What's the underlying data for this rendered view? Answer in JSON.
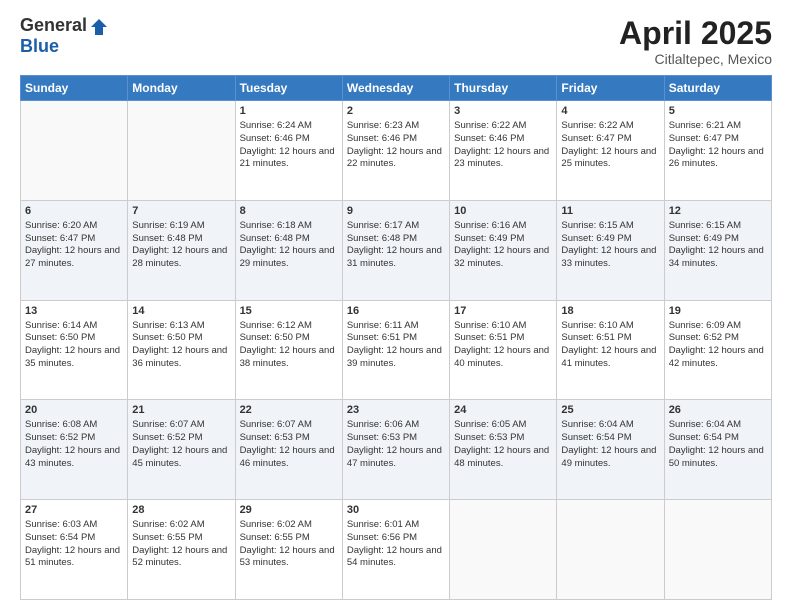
{
  "header": {
    "logo_general": "General",
    "logo_blue": "Blue",
    "title": "April 2025",
    "location": "Citlaltepec, Mexico"
  },
  "days_of_week": [
    "Sunday",
    "Monday",
    "Tuesday",
    "Wednesday",
    "Thursday",
    "Friday",
    "Saturday"
  ],
  "weeks": [
    [
      {
        "day": "",
        "sunrise": "",
        "sunset": "",
        "daylight": ""
      },
      {
        "day": "",
        "sunrise": "",
        "sunset": "",
        "daylight": ""
      },
      {
        "day": "1",
        "sunrise": "Sunrise: 6:24 AM",
        "sunset": "Sunset: 6:46 PM",
        "daylight": "Daylight: 12 hours and 21 minutes."
      },
      {
        "day": "2",
        "sunrise": "Sunrise: 6:23 AM",
        "sunset": "Sunset: 6:46 PM",
        "daylight": "Daylight: 12 hours and 22 minutes."
      },
      {
        "day": "3",
        "sunrise": "Sunrise: 6:22 AM",
        "sunset": "Sunset: 6:46 PM",
        "daylight": "Daylight: 12 hours and 23 minutes."
      },
      {
        "day": "4",
        "sunrise": "Sunrise: 6:22 AM",
        "sunset": "Sunset: 6:47 PM",
        "daylight": "Daylight: 12 hours and 25 minutes."
      },
      {
        "day": "5",
        "sunrise": "Sunrise: 6:21 AM",
        "sunset": "Sunset: 6:47 PM",
        "daylight": "Daylight: 12 hours and 26 minutes."
      }
    ],
    [
      {
        "day": "6",
        "sunrise": "Sunrise: 6:20 AM",
        "sunset": "Sunset: 6:47 PM",
        "daylight": "Daylight: 12 hours and 27 minutes."
      },
      {
        "day": "7",
        "sunrise": "Sunrise: 6:19 AM",
        "sunset": "Sunset: 6:48 PM",
        "daylight": "Daylight: 12 hours and 28 minutes."
      },
      {
        "day": "8",
        "sunrise": "Sunrise: 6:18 AM",
        "sunset": "Sunset: 6:48 PM",
        "daylight": "Daylight: 12 hours and 29 minutes."
      },
      {
        "day": "9",
        "sunrise": "Sunrise: 6:17 AM",
        "sunset": "Sunset: 6:48 PM",
        "daylight": "Daylight: 12 hours and 31 minutes."
      },
      {
        "day": "10",
        "sunrise": "Sunrise: 6:16 AM",
        "sunset": "Sunset: 6:49 PM",
        "daylight": "Daylight: 12 hours and 32 minutes."
      },
      {
        "day": "11",
        "sunrise": "Sunrise: 6:15 AM",
        "sunset": "Sunset: 6:49 PM",
        "daylight": "Daylight: 12 hours and 33 minutes."
      },
      {
        "day": "12",
        "sunrise": "Sunrise: 6:15 AM",
        "sunset": "Sunset: 6:49 PM",
        "daylight": "Daylight: 12 hours and 34 minutes."
      }
    ],
    [
      {
        "day": "13",
        "sunrise": "Sunrise: 6:14 AM",
        "sunset": "Sunset: 6:50 PM",
        "daylight": "Daylight: 12 hours and 35 minutes."
      },
      {
        "day": "14",
        "sunrise": "Sunrise: 6:13 AM",
        "sunset": "Sunset: 6:50 PM",
        "daylight": "Daylight: 12 hours and 36 minutes."
      },
      {
        "day": "15",
        "sunrise": "Sunrise: 6:12 AM",
        "sunset": "Sunset: 6:50 PM",
        "daylight": "Daylight: 12 hours and 38 minutes."
      },
      {
        "day": "16",
        "sunrise": "Sunrise: 6:11 AM",
        "sunset": "Sunset: 6:51 PM",
        "daylight": "Daylight: 12 hours and 39 minutes."
      },
      {
        "day": "17",
        "sunrise": "Sunrise: 6:10 AM",
        "sunset": "Sunset: 6:51 PM",
        "daylight": "Daylight: 12 hours and 40 minutes."
      },
      {
        "day": "18",
        "sunrise": "Sunrise: 6:10 AM",
        "sunset": "Sunset: 6:51 PM",
        "daylight": "Daylight: 12 hours and 41 minutes."
      },
      {
        "day": "19",
        "sunrise": "Sunrise: 6:09 AM",
        "sunset": "Sunset: 6:52 PM",
        "daylight": "Daylight: 12 hours and 42 minutes."
      }
    ],
    [
      {
        "day": "20",
        "sunrise": "Sunrise: 6:08 AM",
        "sunset": "Sunset: 6:52 PM",
        "daylight": "Daylight: 12 hours and 43 minutes."
      },
      {
        "day": "21",
        "sunrise": "Sunrise: 6:07 AM",
        "sunset": "Sunset: 6:52 PM",
        "daylight": "Daylight: 12 hours and 45 minutes."
      },
      {
        "day": "22",
        "sunrise": "Sunrise: 6:07 AM",
        "sunset": "Sunset: 6:53 PM",
        "daylight": "Daylight: 12 hours and 46 minutes."
      },
      {
        "day": "23",
        "sunrise": "Sunrise: 6:06 AM",
        "sunset": "Sunset: 6:53 PM",
        "daylight": "Daylight: 12 hours and 47 minutes."
      },
      {
        "day": "24",
        "sunrise": "Sunrise: 6:05 AM",
        "sunset": "Sunset: 6:53 PM",
        "daylight": "Daylight: 12 hours and 48 minutes."
      },
      {
        "day": "25",
        "sunrise": "Sunrise: 6:04 AM",
        "sunset": "Sunset: 6:54 PM",
        "daylight": "Daylight: 12 hours and 49 minutes."
      },
      {
        "day": "26",
        "sunrise": "Sunrise: 6:04 AM",
        "sunset": "Sunset: 6:54 PM",
        "daylight": "Daylight: 12 hours and 50 minutes."
      }
    ],
    [
      {
        "day": "27",
        "sunrise": "Sunrise: 6:03 AM",
        "sunset": "Sunset: 6:54 PM",
        "daylight": "Daylight: 12 hours and 51 minutes."
      },
      {
        "day": "28",
        "sunrise": "Sunrise: 6:02 AM",
        "sunset": "Sunset: 6:55 PM",
        "daylight": "Daylight: 12 hours and 52 minutes."
      },
      {
        "day": "29",
        "sunrise": "Sunrise: 6:02 AM",
        "sunset": "Sunset: 6:55 PM",
        "daylight": "Daylight: 12 hours and 53 minutes."
      },
      {
        "day": "30",
        "sunrise": "Sunrise: 6:01 AM",
        "sunset": "Sunset: 6:56 PM",
        "daylight": "Daylight: 12 hours and 54 minutes."
      },
      {
        "day": "",
        "sunrise": "",
        "sunset": "",
        "daylight": ""
      },
      {
        "day": "",
        "sunrise": "",
        "sunset": "",
        "daylight": ""
      },
      {
        "day": "",
        "sunrise": "",
        "sunset": "",
        "daylight": ""
      }
    ]
  ]
}
